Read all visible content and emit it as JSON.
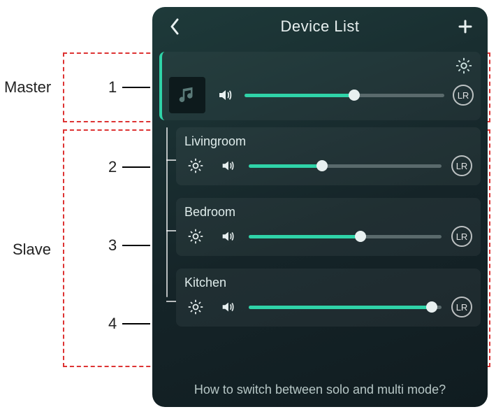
{
  "header": {
    "title": "Device List"
  },
  "master": {
    "name": "",
    "volume_pct": 55,
    "channel": "LR"
  },
  "slaves": [
    {
      "name": "Livingroom",
      "volume_pct": 38,
      "channel": "LR"
    },
    {
      "name": "Bedroom",
      "volume_pct": 58,
      "channel": "LR"
    },
    {
      "name": "Kitchen",
      "volume_pct": 95,
      "channel": "LR"
    }
  ],
  "footer": {
    "hint": "How to switch between solo and multi mode?"
  },
  "annotations": {
    "master_label": "Master",
    "slave_label": "Slave",
    "nums": [
      "1",
      "2",
      "3",
      "4"
    ]
  }
}
